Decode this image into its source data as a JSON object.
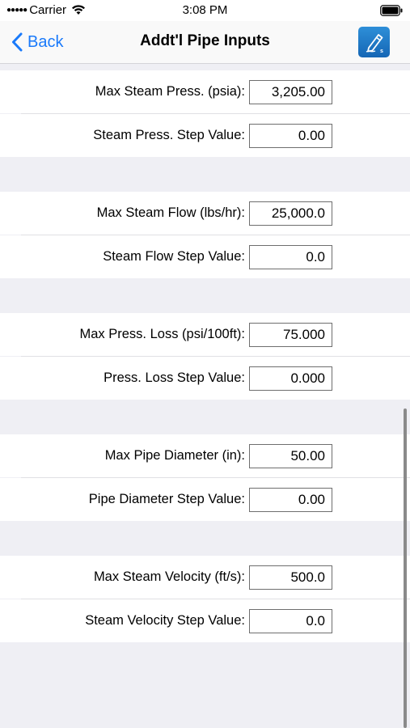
{
  "status_bar": {
    "carrier": "Carrier",
    "time": "3:08 PM"
  },
  "nav": {
    "back_label": "Back",
    "title": "Addt'l Pipe Inputs",
    "icon": "edit-sheet-icon"
  },
  "fields": [
    {
      "label": "Max Steam Press. (psia):",
      "value": "3,205.00"
    },
    {
      "label": "Steam Press. Step Value:",
      "value": "0.00"
    },
    {
      "label": "Max Steam Flow (lbs/hr):",
      "value": "25,000.0"
    },
    {
      "label": "Steam Flow Step Value:",
      "value": "0.0"
    },
    {
      "label": "Max Press. Loss (psi/100ft):",
      "value": "75.000"
    },
    {
      "label": "Press. Loss Step Value:",
      "value": "0.000"
    },
    {
      "label": "Max Pipe Diameter (in):",
      "value": "50.00"
    },
    {
      "label": "Pipe Diameter Step Value:",
      "value": "0.00"
    },
    {
      "label": "Max Steam Velocity (ft/s):",
      "value": "500.0"
    },
    {
      "label": "Steam Velocity Step Value:",
      "value": "0.0"
    }
  ],
  "colors": {
    "accent": "#1a7afa",
    "group_background": "#efeff4",
    "icon_background": "#1f78c8"
  }
}
